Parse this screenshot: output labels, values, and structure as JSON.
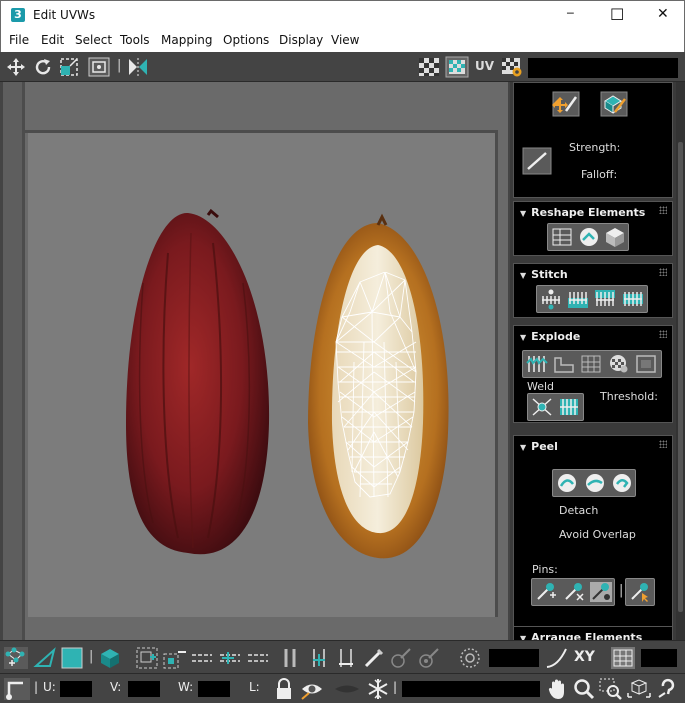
{
  "window": {
    "title": "Edit UVWs",
    "app_badge": "3",
    "min_glyph": "─",
    "max_glyph": "☐",
    "close_glyph": "✕"
  },
  "menu": [
    "File",
    "Edit",
    "Select",
    "Tools",
    "Mapping",
    "Options",
    "Display",
    "View"
  ],
  "toolbar_top": {
    "uv_label": "UV",
    "divider": "|"
  },
  "panel": {
    "paint": {
      "strength_label": "Strength:",
      "falloff_label": "Falloff:"
    },
    "reshape": {
      "title": "Reshape Elements"
    },
    "stitch": {
      "title": "Stitch"
    },
    "explode": {
      "title": "Explode",
      "weld_label": "Weld",
      "threshold_label": "Threshold:"
    },
    "peel": {
      "title": "Peel",
      "detach_label": "Detach",
      "avoid_overlap_label": "Avoid Overlap",
      "pins_label": "Pins:",
      "divider": "|"
    },
    "arrange": {
      "title": "Arrange Elements"
    },
    "collapse_glyph": "▼"
  },
  "bottom_bar_1": {
    "xy_label": "XY",
    "divider": "|"
  },
  "bottom_bar_2": {
    "u_label": "U:",
    "v_label": "V:",
    "w_label": "W:",
    "l_label": "L:",
    "divider": "|"
  },
  "colors": {
    "accent_teal": "#2fb3b3",
    "panel_black": "#000000",
    "ui_gray": "#444444",
    "pod_red": "#8a1f22",
    "pod_orange": "#c88a2a"
  }
}
